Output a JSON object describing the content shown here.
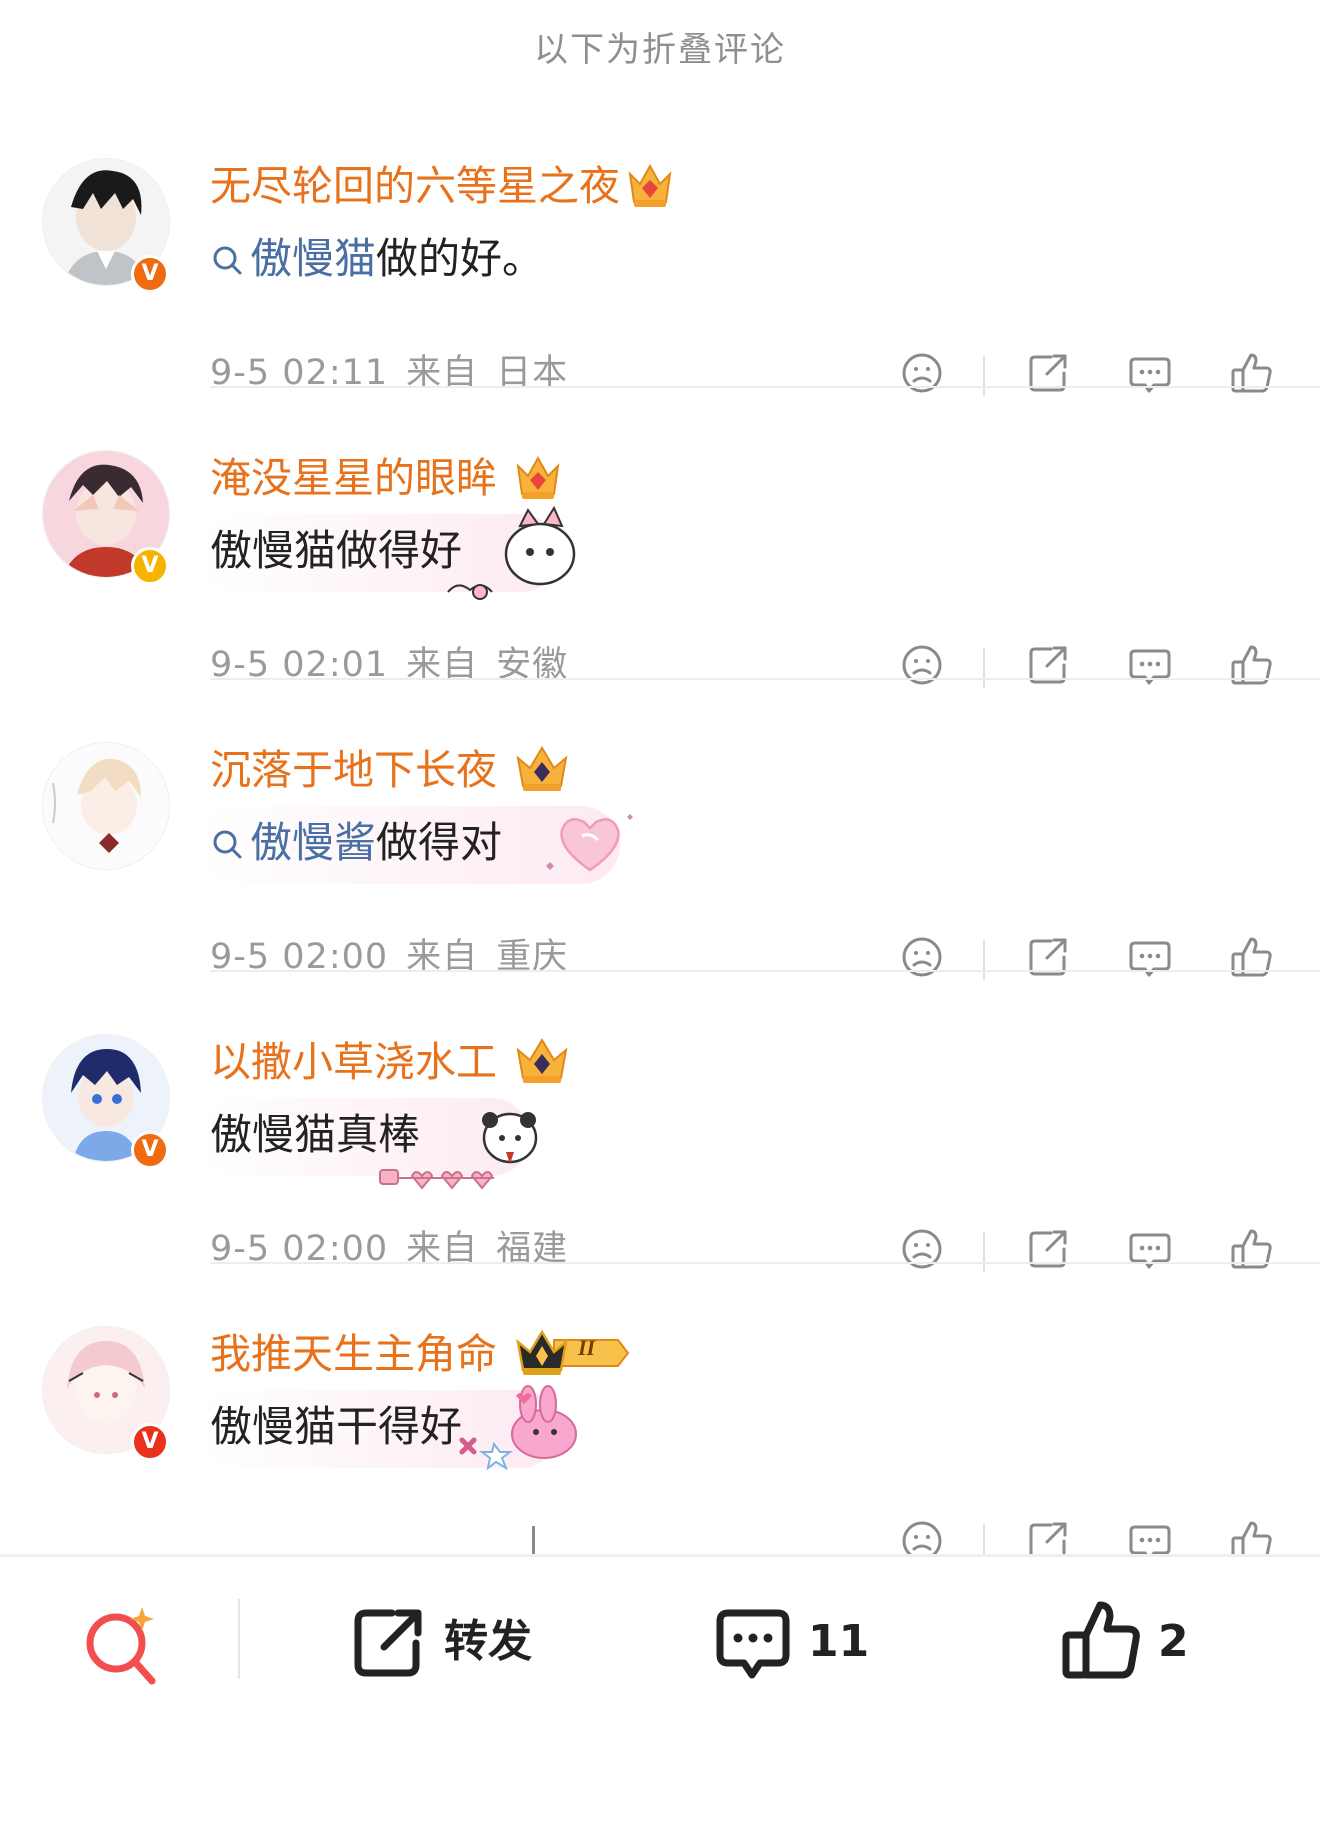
{
  "header": {
    "fold_label": "以下为折叠评论"
  },
  "comments": [
    {
      "username": "无尽轮回的六等星之夜",
      "link_text": "傲慢猫",
      "body_suffix": "做的好。",
      "has_search_icon": true,
      "time": "9-5 02:11",
      "from_label": "来自",
      "location": "日本",
      "badge_letter": "V",
      "badge_color": "#f06a0f"
    },
    {
      "username": "淹没星星的眼眸",
      "link_text": "",
      "body_suffix": "傲慢猫做得好",
      "has_search_icon": false,
      "time": "9-5 02:01",
      "from_label": "来自",
      "location": "安徽",
      "badge_letter": "V",
      "badge_color": "#f4b400"
    },
    {
      "username": "沉落于地下长夜",
      "link_text": "傲慢酱",
      "body_suffix": "做得对",
      "has_search_icon": true,
      "time": "9-5 02:00",
      "from_label": "来自",
      "location": "重庆",
      "badge_letter": "",
      "badge_color": ""
    },
    {
      "username": "以撒小草浇水工",
      "link_text": "",
      "body_suffix": "傲慢猫真棒",
      "has_search_icon": false,
      "time": "9-5 02:00",
      "from_label": "来自",
      "location": "福建",
      "badge_letter": "V",
      "badge_color": "#f06a0f"
    },
    {
      "username": "我推天生主角命",
      "link_text": "",
      "body_suffix": "傲慢猫干得好",
      "has_search_icon": false,
      "time": "",
      "from_label": "",
      "location": "",
      "badge_letter": "V",
      "badge_color": "#e8321c",
      "level_badge": "II"
    }
  ],
  "bottom_bar": {
    "repost_label": "转发",
    "comment_count": "11",
    "like_count": "2"
  },
  "icons": {
    "dislike": "frown-face-icon",
    "share": "share-icon",
    "reply": "comment-bubble-icon",
    "like": "thumbs-up-icon",
    "search": "search-sparkle-icon"
  },
  "colors": {
    "username": "#e8721c",
    "link": "#4a6fa3",
    "meta": "#9a9a9a",
    "search_accent": "#f24e4e"
  }
}
